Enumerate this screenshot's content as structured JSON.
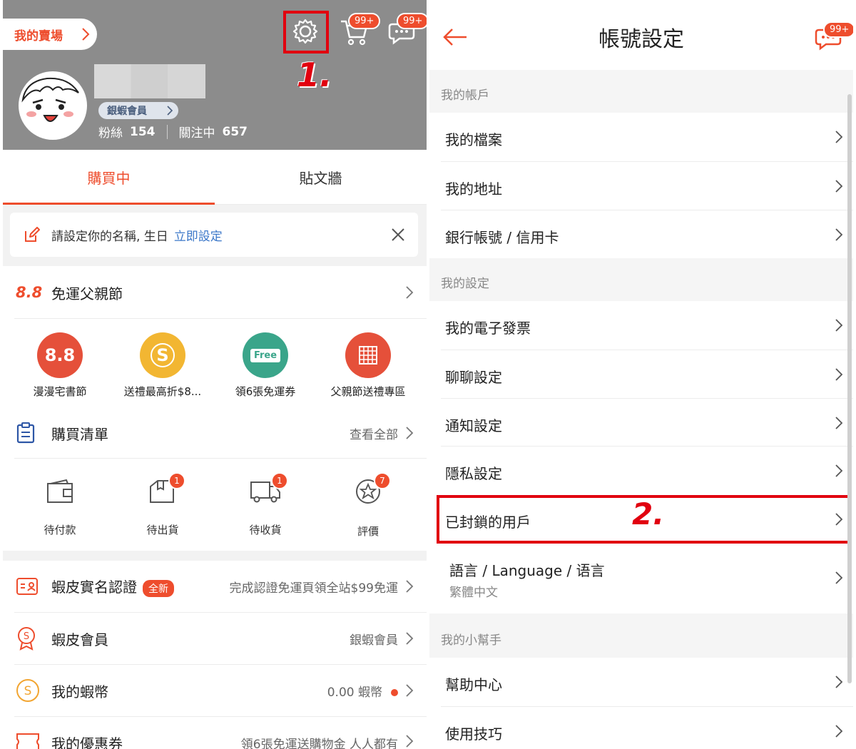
{
  "left": {
    "seller_center": "我的賣場",
    "cart_badge": "99+",
    "chat_badge": "99+",
    "step1": "1.",
    "member_level": "銀蝦會員",
    "followers_label": "粉絲",
    "followers_count": "154",
    "following_label": "關注中",
    "following_count": "657",
    "tabs": [
      "購買中",
      "貼文牆"
    ],
    "notice_text": "請設定你的名稱, 生日",
    "notice_link": "立即設定",
    "campaign_badge": "8.8",
    "campaign_label": "免運父親節",
    "promos": [
      {
        "icon_text": "8.8",
        "label": "漫漫宅書節",
        "color": "#e5503a"
      },
      {
        "icon_text": "S",
        "label": "送禮最高折$8...",
        "color": "#f2b632"
      },
      {
        "icon_text": "Free",
        "label": "領6張免運券",
        "color": "#3aa58a"
      },
      {
        "icon_text": "",
        "label": "父親節送禮專區",
        "color": "#e5503a"
      }
    ],
    "purchases_label": "購買清單",
    "purchases_view_all": "查看全部",
    "order_status": [
      {
        "label": "待付款",
        "count": ""
      },
      {
        "label": "待出貨",
        "count": "1"
      },
      {
        "label": "待收貨",
        "count": "1"
      },
      {
        "label": "評價",
        "count": "7"
      }
    ],
    "verify_label": "蝦皮實名認證",
    "verify_badge": "全新",
    "verify_value": "完成認證免運頁領全站$99免運",
    "member_label": "蝦皮會員",
    "member_value": "銀蝦會員",
    "coins_label": "我的蝦幣",
    "coins_value": "0.00 蝦幣",
    "vouchers_label": "我的優惠券",
    "vouchers_value": "領6張免運送購物金 人人都有"
  },
  "right": {
    "title": "帳號設定",
    "chat_badge": "99+",
    "step2": "2.",
    "sections": {
      "account": "我的帳戶",
      "settings": "我的設定",
      "helper": "我的小幫手"
    },
    "account_items": [
      "我的檔案",
      "我的地址",
      "銀行帳號 / 信用卡"
    ],
    "settings_items": [
      "我的電子發票",
      "聊聊設定",
      "通知設定",
      "隱私設定",
      "已封鎖的用戶"
    ],
    "language_label": "語言 / Language / 语言",
    "language_value": "繁體中文",
    "helper_items": [
      "幫助中心",
      "使用技巧"
    ]
  },
  "colors": {
    "brand": "#ee4d2d",
    "highlight": "#e1000f",
    "header_bg": "#8c8c8c"
  }
}
